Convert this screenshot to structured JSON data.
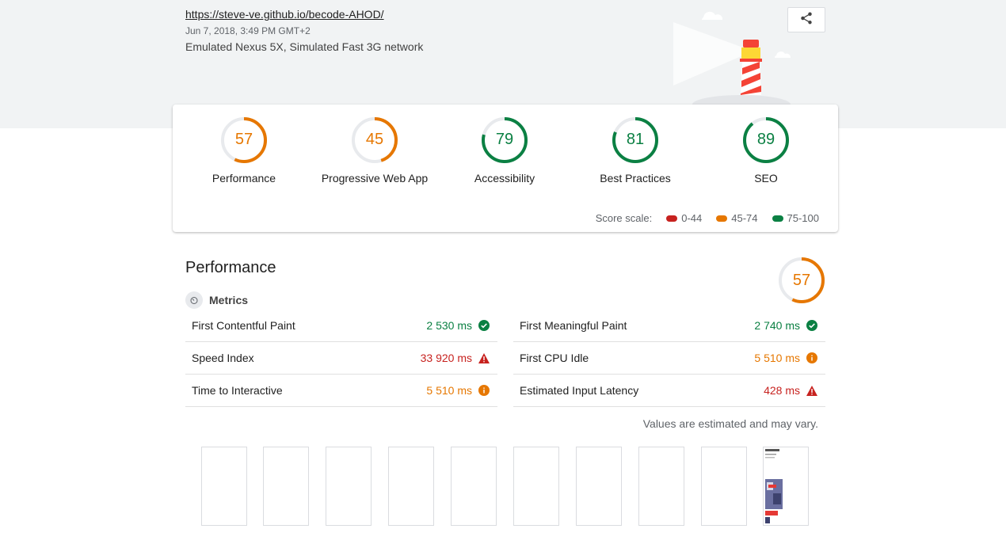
{
  "report": {
    "url": "https://steve-ve.github.io/becode-AHOD/",
    "date": "Jun 7, 2018, 3:49 PM GMT+2",
    "environment": "Emulated Nexus 5X, Simulated Fast 3G network"
  },
  "categories": [
    {
      "label": "Performance",
      "score": "57",
      "fraction": 0.57,
      "color": "#e67700"
    },
    {
      "label": "Progressive Web App",
      "score": "45",
      "fraction": 0.45,
      "color": "#e67700"
    },
    {
      "label": "Accessibility",
      "score": "79",
      "fraction": 0.79,
      "color": "#0b8043"
    },
    {
      "label": "Best Practices",
      "score": "81",
      "fraction": 0.81,
      "color": "#0b8043"
    },
    {
      "label": "SEO",
      "score": "89",
      "fraction": 0.89,
      "color": "#0b8043"
    }
  ],
  "scale": {
    "label": "Score scale:",
    "ranges": [
      {
        "label": "0-44",
        "color": "#c7221f"
      },
      {
        "label": "45-74",
        "color": "#e67700"
      },
      {
        "label": "75-100",
        "color": "#0b8043"
      }
    ]
  },
  "performance": {
    "title": "Performance",
    "score": "57",
    "fraction": 0.57,
    "metrics_heading": "Metrics",
    "note": "Values are estimated and may vary.",
    "metrics_left": [
      {
        "name": "First Contentful Paint",
        "value": "2 530 ms",
        "status": "pass"
      },
      {
        "name": "Speed Index",
        "value": "33 920 ms",
        "status": "fail"
      },
      {
        "name": "Time to Interactive",
        "value": "5 510 ms",
        "status": "average"
      }
    ],
    "metrics_right": [
      {
        "name": "First Meaningful Paint",
        "value": "2 740 ms",
        "status": "pass"
      },
      {
        "name": "First CPU Idle",
        "value": "5 510 ms",
        "status": "average"
      },
      {
        "name": "Estimated Input Latency",
        "value": "428 ms",
        "status": "fail"
      }
    ]
  },
  "icons": {
    "share": "share-icon",
    "pass": "check-circle-icon",
    "average": "info-circle-icon",
    "fail": "warning-triangle-icon",
    "metrics": "timer-icon"
  }
}
